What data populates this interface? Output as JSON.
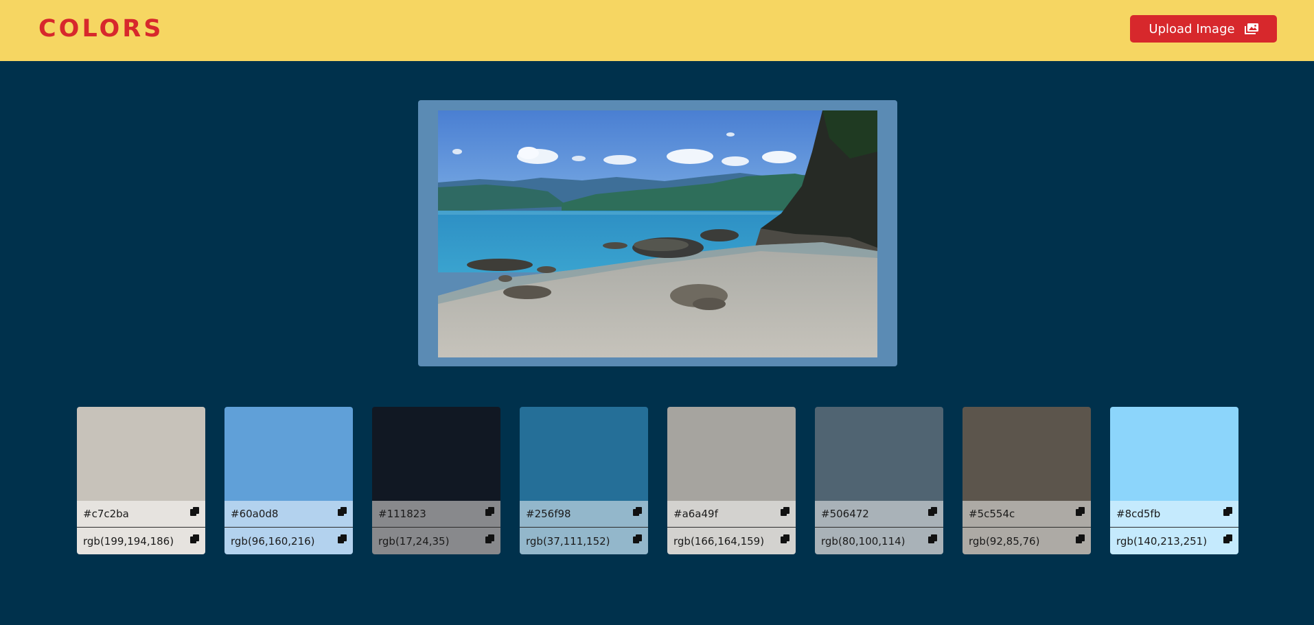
{
  "header": {
    "logo": "COLORS",
    "upload_label": "Upload Image",
    "upload_icon": "image-icon",
    "background": "#f6d662",
    "accent": "#d7282c"
  },
  "page": {
    "background": "#00314c"
  },
  "preview": {
    "frame_color": "#5b8bb4",
    "image_icon": "beach-photo"
  },
  "swatches": [
    {
      "hex": "#c7c2ba",
      "rgb": "rgb(199,194,186)",
      "color": "#c7c2ba",
      "row_bg": "#e6e3df"
    },
    {
      "hex": "#60a0d8",
      "rgb": "rgb(96,160,216)",
      "color": "#60a0d8",
      "row_bg": "#b3d2ee"
    },
    {
      "hex": "#111823",
      "rgb": "rgb(17,24,35)",
      "color": "#111823",
      "row_bg": "#88898c"
    },
    {
      "hex": "#256f98",
      "rgb": "rgb(37,111,152)",
      "color": "#256f98",
      "row_bg": "#93b7cb"
    },
    {
      "hex": "#a6a49f",
      "rgb": "rgb(166,164,159)",
      "color": "#a6a49f",
      "row_bg": "#d3d2cf"
    },
    {
      "hex": "#506472",
      "rgb": "rgb(80,100,114)",
      "color": "#506472",
      "row_bg": "#a9b2b8"
    },
    {
      "hex": "#5c554c",
      "rgb": "rgb(92,85,76)",
      "color": "#5c554c",
      "row_bg": "#adaaa5"
    },
    {
      "hex": "#8cd5fb",
      "rgb": "rgb(140,213,251)",
      "color": "#8cd5fb",
      "row_bg": "#c5eafd"
    }
  ]
}
